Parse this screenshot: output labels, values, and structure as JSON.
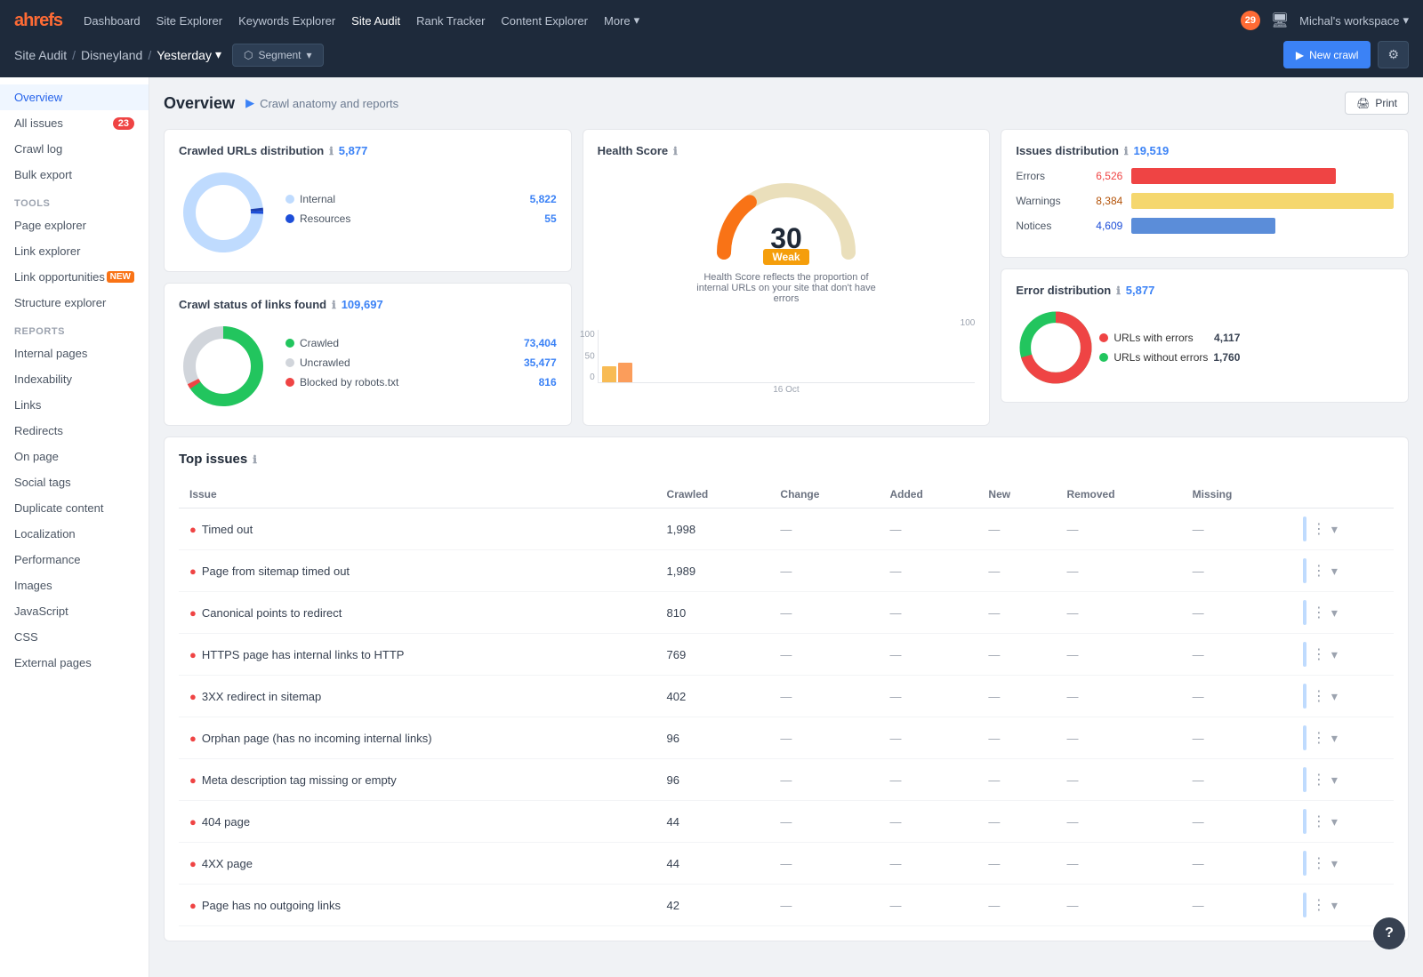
{
  "nav": {
    "logo": "ahrefs",
    "links": [
      "Dashboard",
      "Site Explorer",
      "Keywords Explorer",
      "Site Audit",
      "Rank Tracker",
      "Content Explorer"
    ],
    "active": "Site Audit",
    "more": "More",
    "notifications": "29",
    "workspace": "Michal's workspace"
  },
  "breadcrumb": {
    "root": "Site Audit",
    "site": "Disneyland",
    "period": "Yesterday",
    "segment_label": "Segment"
  },
  "buttons": {
    "new_crawl": "New crawl",
    "print": "Print",
    "crawl_anatomy": "Crawl anatomy and reports"
  },
  "page_title": "Overview",
  "sidebar": {
    "top_items": [
      "Overview",
      "All issues",
      "Crawl log",
      "Bulk export"
    ],
    "all_issues_badge": "23",
    "tools_label": "Tools",
    "tools_items": [
      "Page explorer",
      "Link explorer",
      "Link opportunities",
      "Structure explorer"
    ],
    "link_opportunities_new": true,
    "reports_label": "Reports",
    "reports_items": [
      "Internal pages",
      "Indexability",
      "Links",
      "Redirects",
      "On page",
      "Social tags",
      "Duplicate content",
      "Localization",
      "Performance"
    ],
    "other_items": [
      "Images",
      "JavaScript",
      "CSS",
      "External pages"
    ]
  },
  "crawled_urls": {
    "title": "Crawled URLs distribution",
    "count": "5,877",
    "internal_label": "Internal",
    "internal_value": "5,822",
    "resources_label": "Resources",
    "resources_value": "55"
  },
  "crawl_status": {
    "title": "Crawl status of links found",
    "count": "109,697",
    "crawled_label": "Crawled",
    "crawled_value": "73,404",
    "uncrawled_label": "Uncrawled",
    "uncrawled_value": "35,477",
    "blocked_label": "Blocked by robots.txt",
    "blocked_value": "816"
  },
  "health_score": {
    "title": "Health Score",
    "score": "30",
    "label": "Weak",
    "description": "Health Score reflects the proportion of internal URLs on your site that don't have errors",
    "date_label": "16 Oct",
    "axis_100": "100",
    "axis_50": "50",
    "axis_0": "0"
  },
  "issues_distribution": {
    "title": "Issues distribution",
    "count": "19,519",
    "errors_label": "Errors",
    "errors_value": "6,526",
    "warnings_label": "Warnings",
    "warnings_value": "8,384",
    "notices_label": "Notices",
    "notices_value": "4,609"
  },
  "error_distribution": {
    "title": "Error distribution",
    "count": "5,877",
    "urls_errors_label": "URLs with errors",
    "urls_errors_value": "4,117",
    "urls_no_errors_label": "URLs without errors",
    "urls_no_errors_value": "1,760"
  },
  "top_issues": {
    "title": "Top issues",
    "columns": [
      "Issue",
      "Crawled",
      "Change",
      "Added",
      "New",
      "Removed",
      "Missing"
    ],
    "rows": [
      {
        "issue": "Timed out",
        "crawled": "1,998",
        "change": "—",
        "added": "—",
        "new": "—",
        "removed": "—",
        "missing": "—"
      },
      {
        "issue": "Page from sitemap timed out",
        "crawled": "1,989",
        "change": "—",
        "added": "—",
        "new": "—",
        "removed": "—",
        "missing": "—"
      },
      {
        "issue": "Canonical points to redirect",
        "crawled": "810",
        "change": "—",
        "added": "—",
        "new": "—",
        "removed": "—",
        "missing": "—"
      },
      {
        "issue": "HTTPS page has internal links to HTTP",
        "crawled": "769",
        "change": "—",
        "added": "—",
        "new": "—",
        "removed": "—",
        "missing": "—"
      },
      {
        "issue": "3XX redirect in sitemap",
        "crawled": "402",
        "change": "—",
        "added": "—",
        "new": "—",
        "removed": "—",
        "missing": "—"
      },
      {
        "issue": "Orphan page (has no incoming internal links)",
        "crawled": "96",
        "change": "—",
        "added": "—",
        "new": "—",
        "removed": "—",
        "missing": "—"
      },
      {
        "issue": "Meta description tag missing or empty",
        "crawled": "96",
        "change": "—",
        "added": "—",
        "new": "—",
        "removed": "—",
        "missing": "—"
      },
      {
        "issue": "404 page",
        "crawled": "44",
        "change": "—",
        "added": "—",
        "new": "—",
        "removed": "—",
        "missing": "—"
      },
      {
        "issue": "4XX page",
        "crawled": "44",
        "change": "—",
        "added": "—",
        "new": "—",
        "removed": "—",
        "missing": "—"
      },
      {
        "issue": "Page has no outgoing links",
        "crawled": "42",
        "change": "—",
        "added": "—",
        "new": "—",
        "removed": "—",
        "missing": "—"
      }
    ]
  },
  "colors": {
    "brand_blue": "#3b82f6",
    "error_red": "#ef4444",
    "warning_yellow": "#f5d76e",
    "notice_blue": "#5b8dd9",
    "crawled_green": "#22c55e",
    "uncrawled_gray": "#d1d5db",
    "blocked_red": "#ef4444",
    "donut_light_blue": "#bfdbfe",
    "donut_dark_blue": "#1d4ed8",
    "gauge_orange": "#f97316",
    "gauge_yellow": "#eab308"
  }
}
